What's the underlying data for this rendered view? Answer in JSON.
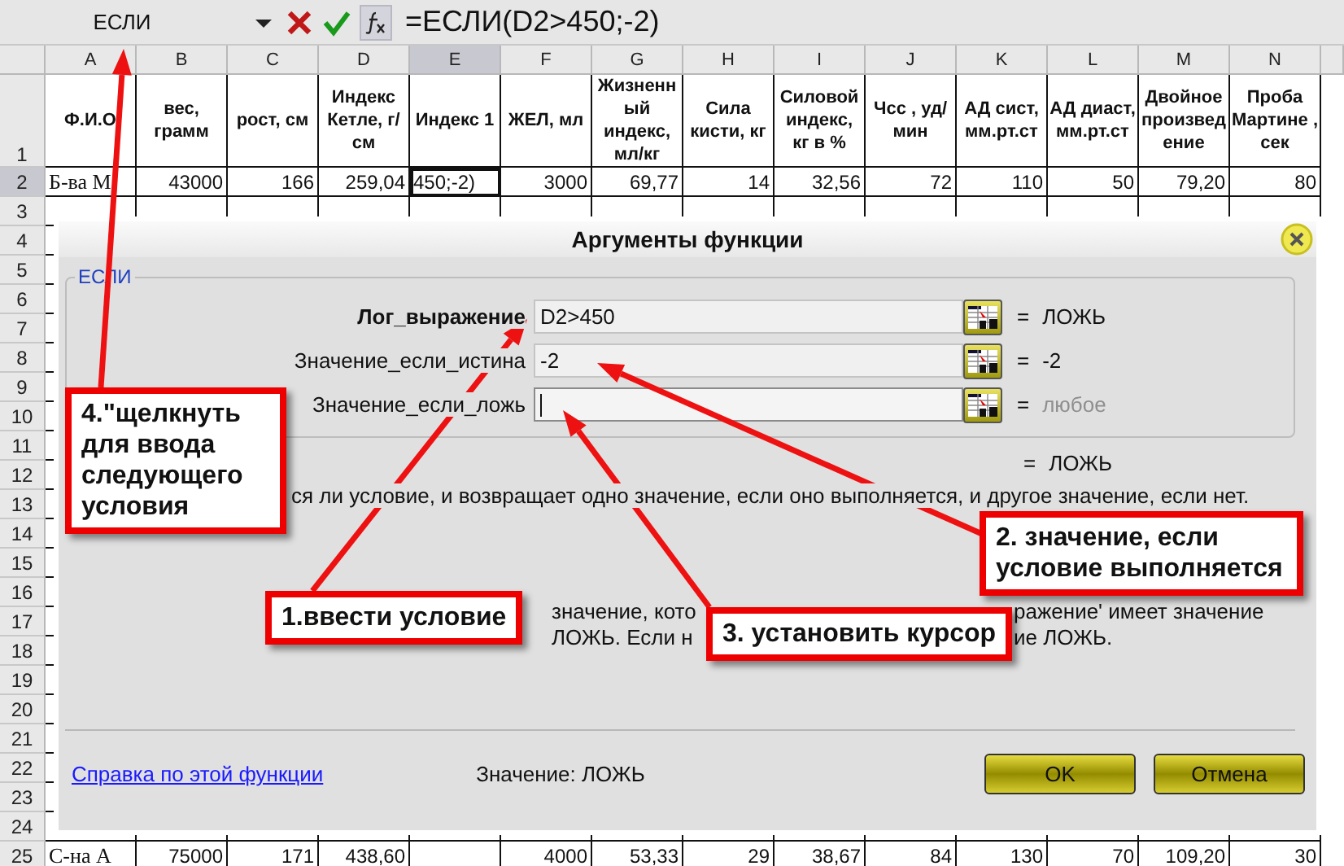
{
  "formula_bar": {
    "name_box": "ЕСЛИ",
    "formula": "=ЕСЛИ(D2>450;-2)"
  },
  "sheet": {
    "columns": [
      {
        "label": "A",
        "selected": false
      },
      {
        "label": "B",
        "selected": false
      },
      {
        "label": "C",
        "selected": false
      },
      {
        "label": "D",
        "selected": false
      },
      {
        "label": "E",
        "selected": true
      },
      {
        "label": "F",
        "selected": false
      },
      {
        "label": "G",
        "selected": false
      },
      {
        "label": "H",
        "selected": false
      },
      {
        "label": "I",
        "selected": false
      },
      {
        "label": "J",
        "selected": false
      },
      {
        "label": "K",
        "selected": false
      },
      {
        "label": "L",
        "selected": false
      },
      {
        "label": "M",
        "selected": false
      },
      {
        "label": "N",
        "selected": false
      }
    ],
    "header_row": {
      "number": "1",
      "cells": [
        "Ф.И.О",
        "вес, грамм",
        "рост, см",
        "Индекс Кетле, г/см",
        "Индекс 1",
        "ЖЕЛ, мл",
        "Жизненный индекс, мл/кг",
        "Сила кисти, кг",
        "Силовой индекс, кг в %",
        "Чсс , уд/мин",
        "АД сист, мм.рт.ст",
        "АД диаст, мм.рт.ст",
        "Двойное произведение",
        "Проба Мартине , сек"
      ]
    },
    "rows": [
      {
        "number": "2",
        "selected": true,
        "cells": [
          "Б-ва М",
          "43000",
          "166",
          "259,04",
          "450;-2)",
          "3000",
          "69,77",
          "14",
          "32,56",
          "72",
          "110",
          "50",
          "79,20",
          "80"
        ]
      },
      {
        "number": "3",
        "selected": false
      },
      {
        "number": "4",
        "selected": false
      },
      {
        "number": "5",
        "selected": false
      },
      {
        "number": "6",
        "selected": false
      },
      {
        "number": "7",
        "selected": false
      },
      {
        "number": "8",
        "selected": false
      },
      {
        "number": "9",
        "selected": false
      },
      {
        "number": "10",
        "selected": false
      },
      {
        "number": "11",
        "selected": false
      },
      {
        "number": "12",
        "selected": false
      },
      {
        "number": "13",
        "selected": false
      },
      {
        "number": "14",
        "selected": false
      },
      {
        "number": "15",
        "selected": false
      },
      {
        "number": "16",
        "selected": false
      },
      {
        "number": "17",
        "selected": false
      },
      {
        "number": "18",
        "selected": false
      },
      {
        "number": "19",
        "selected": false
      },
      {
        "number": "20",
        "selected": false
      },
      {
        "number": "21",
        "selected": false
      },
      {
        "number": "22",
        "selected": false
      },
      {
        "number": "23",
        "selected": false
      },
      {
        "number": "24",
        "selected": false
      },
      {
        "number": "25",
        "selected": false,
        "cells": [
          "С-на А",
          "75000",
          "171",
          "438,60",
          "",
          "4000",
          "53,33",
          "29",
          "38,67",
          "84",
          "130",
          "70",
          "109,20",
          "30"
        ]
      }
    ]
  },
  "dialog": {
    "title": "Аргументы функции",
    "group": "ЕСЛИ",
    "arguments": [
      {
        "label": "Лог_выражение",
        "value": "D2>450",
        "sign": "=",
        "result": "ЛОЖЬ",
        "bold": true,
        "focused": false,
        "muted": false
      },
      {
        "label": "Значение_если_истина",
        "value": "-2",
        "sign": "=",
        "result": "-2",
        "bold": false,
        "focused": false,
        "muted": false
      },
      {
        "label": "Значение_если_ложь",
        "sign": "=",
        "result": "любое",
        "bold": false,
        "focused": true,
        "muted": true
      }
    ],
    "formula_result": {
      "sign": "=",
      "value": "ЛОЖЬ"
    },
    "description": "ся ли условие, и возвращает одно значение, если оно выполняется, и другое значение, если нет.",
    "help_lines": [
      {
        "parts": [
          "значение, кото",
          "ражение' имеет значение"
        ]
      },
      {
        "parts": [
          "ЛОЖЬ. Если н",
          "ие ЛОЖЬ."
        ]
      }
    ],
    "help_link": "Справка по этой функции",
    "value_text": "Значение: ЛОЖЬ",
    "buttons": [
      "OK",
      "Отмена"
    ]
  },
  "callouts": [
    {
      "text": "4.\"щелкнуть для ввода следующего условия"
    },
    {
      "text": "1.ввести условие"
    },
    {
      "text": "3. установить курсор"
    },
    {
      "text": "2. значение, если условие выполняется"
    }
  ]
}
